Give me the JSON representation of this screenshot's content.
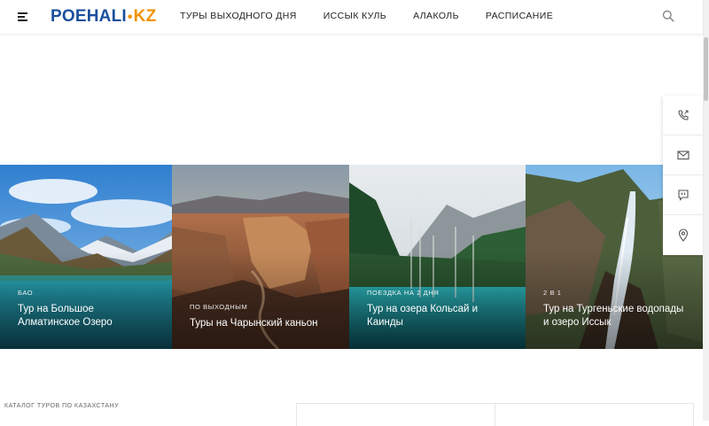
{
  "header": {
    "logo_main": "POEHALI",
    "logo_sep": "•",
    "logo_tld": "KZ",
    "nav": [
      "ТУРЫ ВЫХОДНОГО ДНЯ",
      "ИССЫК КУЛЬ",
      "АЛАКОЛЬ",
      "РАСПИСАНИЕ"
    ],
    "search_icon": "search-icon",
    "menu_icon": "hamburger-icon"
  },
  "side_panel": {
    "items": [
      "phone-icon",
      "mail-icon",
      "chat-icon",
      "location-icon"
    ]
  },
  "cards": [
    {
      "tag": "БАО",
      "title": "Тур на Большое Алматинское Озеро"
    },
    {
      "tag": "ПО ВЫХОДНЫМ",
      "title": "Туры на Чарынский каньон"
    },
    {
      "tag": "ПОЕЗДКА НА 2 ДНЯ",
      "title": "Тур на озера Кольсай и Каинды"
    },
    {
      "tag": "2 В 1",
      "title": "Тур на Тургеньские водопады и озеро Иссык"
    }
  ],
  "catalog_label": "КАТАЛОГ ТУРОВ ПО КАЗАХСТАНУ",
  "colors": {
    "brand_blue": "#1a4f9c",
    "brand_orange": "#f39200"
  }
}
